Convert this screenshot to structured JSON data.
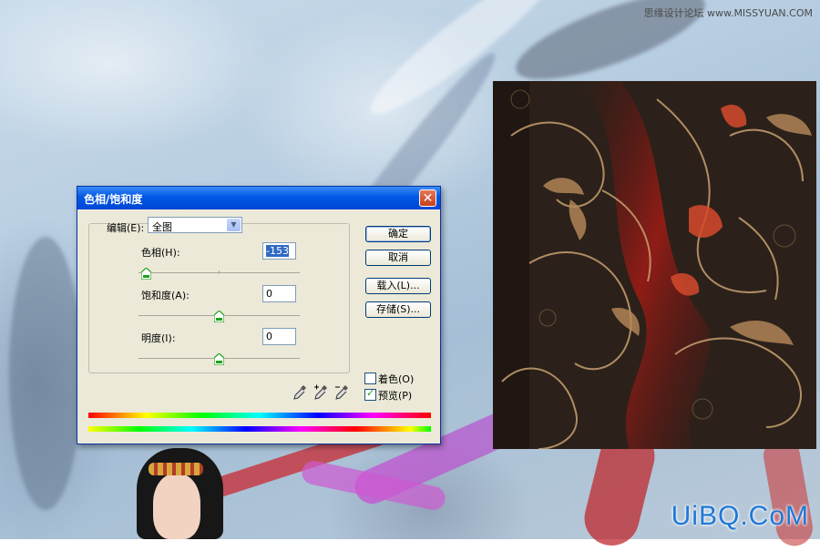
{
  "dialog": {
    "title": "色相/饱和度",
    "close_symbol": "✕",
    "edit_label": "编辑(E):",
    "edit_value": "全图",
    "hue_label": "色相(H):",
    "hue_value": "-153",
    "saturation_label": "饱和度(A):",
    "saturation_value": "0",
    "lightness_label": "明度(I):",
    "lightness_value": "0",
    "buttons": {
      "ok": "确定",
      "cancel": "取消",
      "load": "载入(L)...",
      "save": "存储(S)..."
    },
    "colorize_label": "着色(O)",
    "colorize_checked": false,
    "preview_label": "预览(P)",
    "preview_checked": true,
    "eyedroppers": [
      "eyedropper-icon",
      "eyedropper-plus-icon",
      "eyedropper-minus-icon"
    ]
  },
  "watermarks": {
    "top_right": "思缘设计论坛 www.MISSYUAN.COM",
    "bottom_right": "UiBQ.CoM"
  },
  "colors": {
    "titlebar": "#0058e6",
    "dialog_bg": "#ece9d8",
    "pattern_bg": "#2a2019",
    "uibq_blue": "#1e78d8"
  }
}
